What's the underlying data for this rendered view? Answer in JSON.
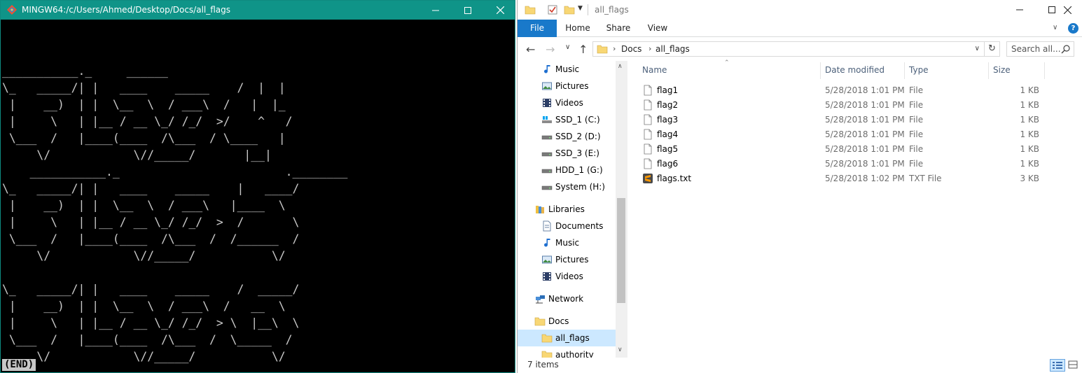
{
  "terminal": {
    "title": "MINGW64:/c/Users/Ahmed/Desktop/Docs/all_flags",
    "ascii_art": [
      "___________._     ______",
      "\\_   _____/| |   ____    _____    /  |  |",
      " |    __)  | |  \\__  \\  / ___\\  /   |  |_",
      " |     \\   | |__ / __ \\_/ /_/  >/    ^   /",
      " \\___  /   |____(____  /\\___  / \\____   |",
      "     \\/            \\//_____/       |__|",
      "    ___________._                        .________",
      "\\_   _____/| |   ____    _____    |   ____/",
      " |    __)  | |  \\__  \\  / ___\\   |____  \\",
      " |     \\   | |__ / __ \\_/ /_/  >  /       \\",
      " \\___  /   |____(____  /\\___  /  /______  /",
      "     \\/            \\//_____/           \\/",
      "",
      "\\_   _____/| |   ____    _____    /  _____/",
      " |    __)  | |  \\__  \\  / ___\\  /   __  \\",
      " |     \\   | |__ / __ \\_/ /_/  > \\  |__\\  \\",
      " \\___  /   |____(____  /\\___  /  \\_____  /",
      "     \\/            \\//_____/           \\/"
    ],
    "end_marker": "(END)"
  },
  "explorer": {
    "title": "all_flags",
    "ribbon_tabs": [
      "File",
      "Home",
      "Share",
      "View"
    ],
    "breadcrumb": [
      "Docs",
      "all_flags"
    ],
    "search_placeholder": "Search all...",
    "nav_items": [
      {
        "label": "Music",
        "icon": "music-icon"
      },
      {
        "label": "Pictures",
        "icon": "pictures-icon"
      },
      {
        "label": "Videos",
        "icon": "videos-icon"
      },
      {
        "label": "SSD_1 (C:)",
        "icon": "system-drive-icon"
      },
      {
        "label": "SSD_2 (D:)",
        "icon": "drive-icon"
      },
      {
        "label": "SSD_3 (E:)",
        "icon": "drive-icon"
      },
      {
        "label": "HDD_1 (G:)",
        "icon": "drive-icon"
      },
      {
        "label": "System (H:)",
        "icon": "drive-icon"
      },
      {
        "label": "Libraries",
        "icon": "libraries-icon"
      },
      {
        "label": "Documents",
        "icon": "documents-icon"
      },
      {
        "label": "Music",
        "icon": "music-icon"
      },
      {
        "label": "Pictures",
        "icon": "pictures-icon"
      },
      {
        "label": "Videos",
        "icon": "videos-icon"
      },
      {
        "label": "Network",
        "icon": "network-icon"
      },
      {
        "label": "Docs",
        "icon": "folder-icon"
      },
      {
        "label": "all_flags",
        "icon": "folder-icon",
        "selected": true
      },
      {
        "label": "authority",
        "icon": "folder-icon"
      }
    ],
    "columns": [
      "Name",
      "Date modified",
      "Type",
      "Size"
    ],
    "files": [
      {
        "name": "flag1",
        "date": "5/28/2018 1:01 PM",
        "type": "File",
        "size": "1 KB",
        "icon": "file-icon"
      },
      {
        "name": "flag2",
        "date": "5/28/2018 1:01 PM",
        "type": "File",
        "size": "1 KB",
        "icon": "file-icon"
      },
      {
        "name": "flag3",
        "date": "5/28/2018 1:01 PM",
        "type": "File",
        "size": "1 KB",
        "icon": "file-icon"
      },
      {
        "name": "flag4",
        "date": "5/28/2018 1:01 PM",
        "type": "File",
        "size": "1 KB",
        "icon": "file-icon"
      },
      {
        "name": "flag5",
        "date": "5/28/2018 1:01 PM",
        "type": "File",
        "size": "1 KB",
        "icon": "file-icon"
      },
      {
        "name": "flag6",
        "date": "5/28/2018 1:01 PM",
        "type": "File",
        "size": "1 KB",
        "icon": "file-icon"
      },
      {
        "name": "flags.txt",
        "date": "5/28/2018 1:02 PM",
        "type": "TXT File",
        "size": "3 KB",
        "icon": "sublime-text-icon"
      }
    ],
    "status": "7 items"
  },
  "colors": {
    "terminal_titlebar": "#0f9488",
    "terminal_text": "#c8c8c8",
    "file_tab": "#1979ca",
    "selection": "#cce8ff",
    "folder": "#f8d775"
  }
}
